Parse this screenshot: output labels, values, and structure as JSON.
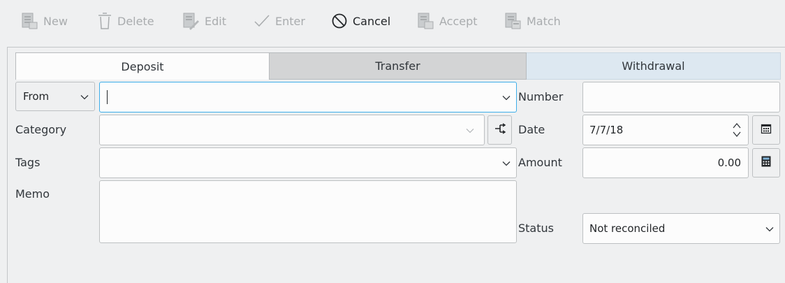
{
  "toolbar": {
    "new_label": "New",
    "delete_label": "Delete",
    "edit_label": "Edit",
    "enter_label": "Enter",
    "cancel_label": "Cancel",
    "accept_label": "Accept",
    "match_label": "Match"
  },
  "tabs": [
    {
      "label": "Deposit",
      "active": true
    },
    {
      "label": "Transfer",
      "active": false
    },
    {
      "label": "Withdrawal",
      "active": false
    }
  ],
  "form": {
    "payee_direction": "From",
    "payee_value": "",
    "category_label": "Category",
    "category_value": "",
    "tags_label": "Tags",
    "tags_value": "",
    "memo_label": "Memo",
    "memo_value": "",
    "number_label": "Number",
    "number_value": "",
    "date_label": "Date",
    "date_value": "7/7/18",
    "amount_label": "Amount",
    "amount_value": "0.00",
    "status_label": "Status",
    "status_value": "Not reconciled"
  },
  "colors": {
    "window_bg": "#eff0f1",
    "field_bg": "#fcfcfc",
    "focus_border": "#3daee9",
    "transfer_tab": "#d3d4d5",
    "withdrawal_tab": "#dde8f1",
    "disabled_text": "#a9acae"
  },
  "icons": {
    "new": "document-new-icon",
    "delete": "trash-icon",
    "edit": "document-edit-icon",
    "enter": "checkmark-icon",
    "cancel": "cancel-icon",
    "accept": "document-accept-icon",
    "match": "document-match-icon",
    "split": "split-icon",
    "calendar": "calendar-icon",
    "calculator": "calculator-icon"
  }
}
